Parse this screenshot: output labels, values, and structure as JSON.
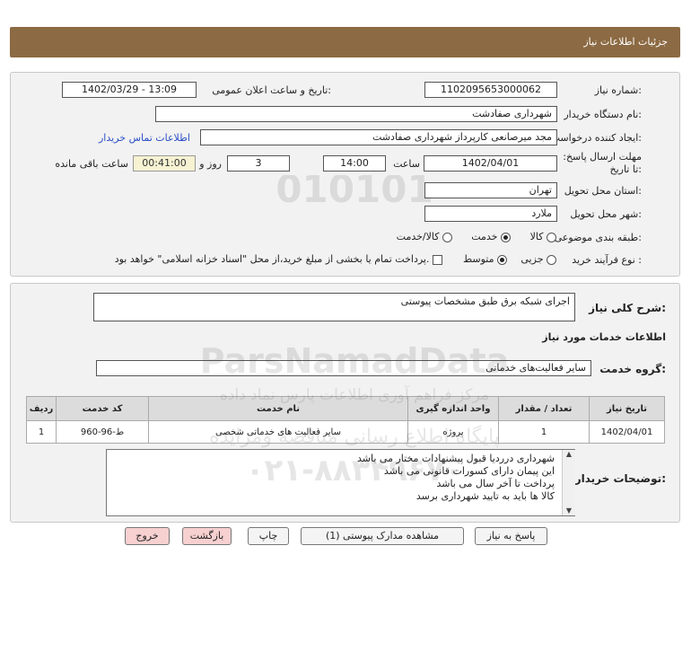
{
  "header": {
    "title": "جزئیات اطلاعات نیاز"
  },
  "form": {
    "need_number_label": "شماره نیاز:",
    "need_number": "1102095653000062",
    "announce_label": "تاریخ و ساعت اعلان عمومی:",
    "announce_value": "1402/03/29 - 13:09",
    "buyer_org_label": "نام دستگاه خریدار:",
    "buyer_org": "شهرداری صفادشت",
    "creator_label": "ایجاد کننده درخواست:",
    "creator": "مجد میرصانعی کارپرداز شهرداری صفادشت",
    "contact_link": "اطلاعات تماس خریدار",
    "deadline_label": "مهلت ارسال پاسخ: تا تاریخ:",
    "deadline_date": "1402/04/01",
    "time_label": "ساعت",
    "deadline_time": "14:00",
    "days_value": "3",
    "days_label": "روز و",
    "remaining_value": "00:41:00",
    "remaining_label": "ساعت باقی مانده",
    "province_label": "استان محل تحویل:",
    "province": "تهران",
    "city_label": "شهر محل تحویل:",
    "city": "ملارد",
    "category_label": "طبقه بندی موضوعی:",
    "category_options": [
      "کالا",
      "خدمت",
      "کالا/خدمت"
    ],
    "category_selected": "خدمت",
    "purchase_type_label": "نوع فرآیند خرید :",
    "purchase_options": [
      "جزیی",
      "متوسط"
    ],
    "purchase_selected": "متوسط",
    "treasury_note": "پرداخت تمام یا بخشی از مبلغ خرید،از محل \"اسناد خزانه اسلامی\" خواهد بود."
  },
  "details": {
    "summary_label": "شرح کلی نیاز:",
    "summary": "اجرای شبکه برق طبق مشخصات پیوستی",
    "services_heading": "اطلاعات خدمات مورد نیاز",
    "service_group_label": "گروه خدمت:",
    "service_group": "سایر فعالیت‌های خدماتی",
    "table": {
      "headers": [
        "ردیف",
        "کد خدمت",
        "نام خدمت",
        "واحد اندازه گیری",
        "تعداد / مقدار",
        "تاریخ نیاز"
      ],
      "rows": [
        [
          "1",
          "ط-96-960",
          "سایر فعالیت های خدماتی شخصی",
          "پروژه",
          "1",
          "1402/04/01"
        ]
      ]
    },
    "buyer_notes_label": "توضیحات خریدار:",
    "buyer_notes": [
      "شهرداری درردیا قبول پیشنهادات مختار می باشد",
      "این پیمان دارای کسورات قانونی می باشد",
      "پرداخت تا  آخر سال می باشد",
      "کالا ها باید به تایید شهرداری برسد"
    ]
  },
  "buttons": {
    "reply": "پاسخ به نیاز",
    "attachments": "مشاهده مدارک پیوستی (1)",
    "print": "چاپ",
    "back": "بازگشت",
    "exit": "خروج"
  },
  "watermark": {
    "brand": "ParsNamadData",
    "numbers": "010101",
    "tagline1": "مرکز فراهم آوری اطلاعات پارس نماد داده",
    "tagline2": "پایگاه اطلاع رسانی مناقصه ومزایده",
    "phone": "۰۲۱-۸۸۳۴۹۶۷۰"
  },
  "colors": {
    "header": "#8c6a43",
    "panel": "#f2f2f2",
    "link": "#2a4fc8",
    "pink_button": "#f7d0d0",
    "remaining_bg": "#f6f2d2"
  }
}
